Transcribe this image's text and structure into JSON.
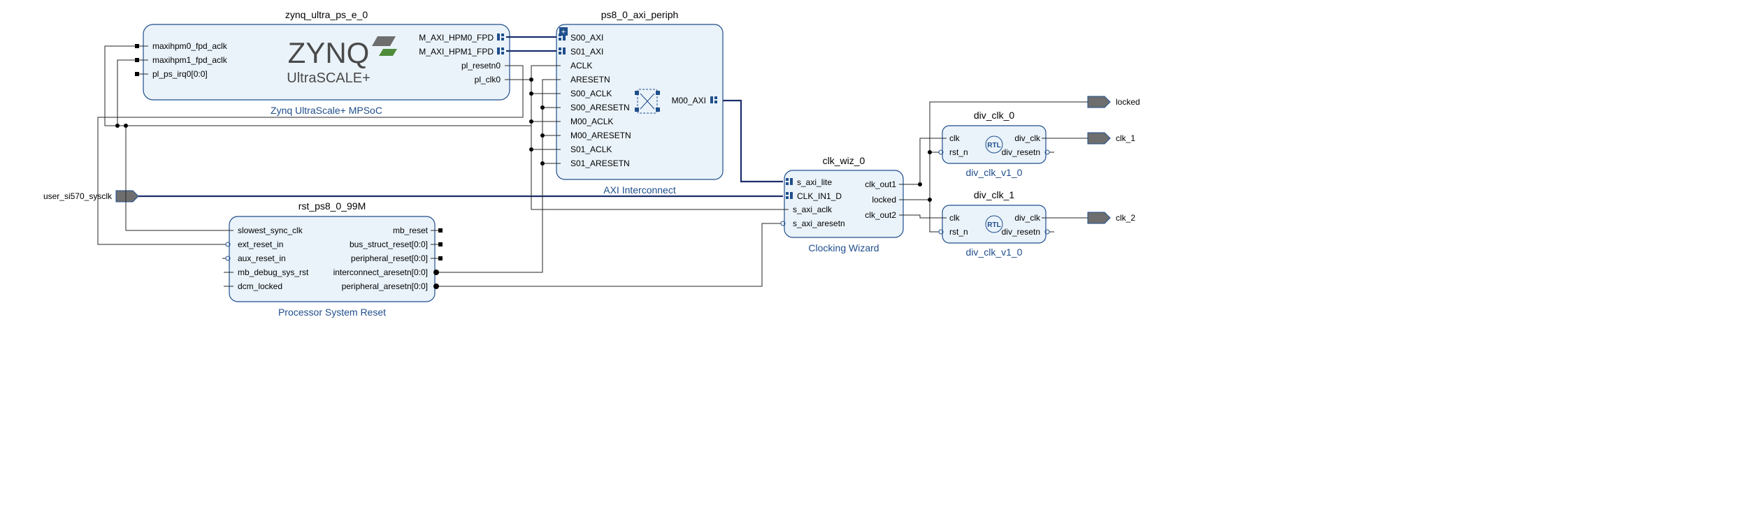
{
  "externalPorts": {
    "input": "user_si570_sysclk",
    "outputs": [
      "locked",
      "clk_1",
      "clk_2"
    ]
  },
  "blocks": {
    "zynq": {
      "instance": "zynq_ultra_ps_e_0",
      "type": "Zynq UltraScale+ MPSoC",
      "logoTop": "ZYNQ",
      "logoBottom": "UltraSCALE+",
      "portsLeft": [
        "maxihpm0_fpd_aclk",
        "maxihpm1_fpd_aclk",
        "pl_ps_irq0[0:0]"
      ],
      "portsRight": [
        "M_AXI_HPM0_FPD",
        "M_AXI_HPM1_FPD",
        "pl_resetn0",
        "pl_clk0"
      ]
    },
    "interconnect": {
      "instance": "ps8_0_axi_periph",
      "type": "AXI Interconnect",
      "portsLeft": [
        "S00_AXI",
        "S01_AXI",
        "ACLK",
        "ARESETN",
        "S00_ACLK",
        "S00_ARESETN",
        "M00_ACLK",
        "M00_ARESETN",
        "S01_ACLK",
        "S01_ARESETN"
      ],
      "portsRight": [
        "M00_AXI"
      ]
    },
    "reset": {
      "instance": "rst_ps8_0_99M",
      "type": "Processor System Reset",
      "portsLeft": [
        "slowest_sync_clk",
        "ext_reset_in",
        "aux_reset_in",
        "mb_debug_sys_rst",
        "dcm_locked"
      ],
      "portsRight": [
        "mb_reset",
        "bus_struct_reset[0:0]",
        "peripheral_reset[0:0]",
        "interconnect_aresetn[0:0]",
        "peripheral_aresetn[0:0]"
      ]
    },
    "clkwiz": {
      "instance": "clk_wiz_0",
      "type": "Clocking Wizard",
      "portsLeft": [
        "s_axi_lite",
        "CLK_IN1_D",
        "s_axi_aclk",
        "s_axi_aresetn"
      ],
      "portsRight": [
        "clk_out1",
        "locked",
        "clk_out2"
      ]
    },
    "div0": {
      "instance": "div_clk_0",
      "type": "div_clk_v1_0",
      "centerLabel": "RTL",
      "portsLeft": [
        "clk",
        "rst_n"
      ],
      "portsRight": [
        "div_clk",
        "div_resetn"
      ]
    },
    "div1": {
      "instance": "div_clk_1",
      "type": "div_clk_v1_0",
      "centerLabel": "RTL",
      "portsLeft": [
        "clk",
        "rst_n"
      ],
      "portsRight": [
        "div_clk",
        "div_resetn"
      ]
    }
  },
  "colors": {
    "blockFill": "#eaf3fa",
    "blockStroke": "#1f4e8c",
    "bus": "#1a2e6b"
  }
}
